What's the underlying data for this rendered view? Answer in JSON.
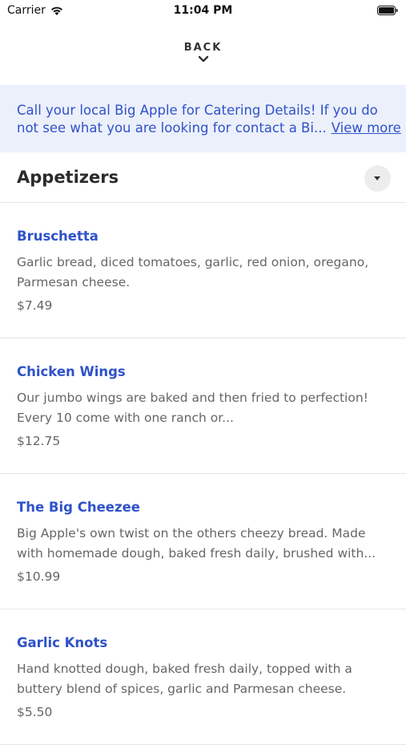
{
  "status_bar": {
    "carrier": "Carrier",
    "time": "11:04 PM"
  },
  "nav": {
    "back_label": "BACK"
  },
  "banner": {
    "line1": "Call your local Big Apple for Catering Details! If you do",
    "line2": "not see what you are looking for contact a Bi...",
    "view_more": "View more"
  },
  "section": {
    "title": "Appetizers"
  },
  "items": [
    {
      "name": "Bruschetta",
      "desc_line1": "Garlic bread, diced tomatoes, garlic, red onion, oregano,",
      "desc_line2": "Parmesan cheese.",
      "price": "$7.49"
    },
    {
      "name": "Chicken Wings",
      "desc_line1": "Our jumbo wings are baked and then fried to perfection!",
      "desc_line2": "Every 10 come with one ranch or...",
      "price": "$12.75"
    },
    {
      "name": "The Big Cheezee",
      "desc_line1": "Big Apple's own twist on the others cheezy bread. Made",
      "desc_line2": "with homemade dough, baked fresh daily, brushed with...",
      "price": "$10.99"
    },
    {
      "name": "Garlic Knots",
      "desc_line1": "Hand knotted dough, baked fresh daily, topped with a",
      "desc_line2": "buttery blend of spices, garlic and Parmesan cheese.",
      "price": "$5.50"
    }
  ],
  "colors": {
    "accent": "#2f52c9",
    "banner_bg": "#ecf0fb"
  },
  "icons": [
    "wifi-icon",
    "battery-icon",
    "chevron-down-icon",
    "caret-down-icon"
  ]
}
